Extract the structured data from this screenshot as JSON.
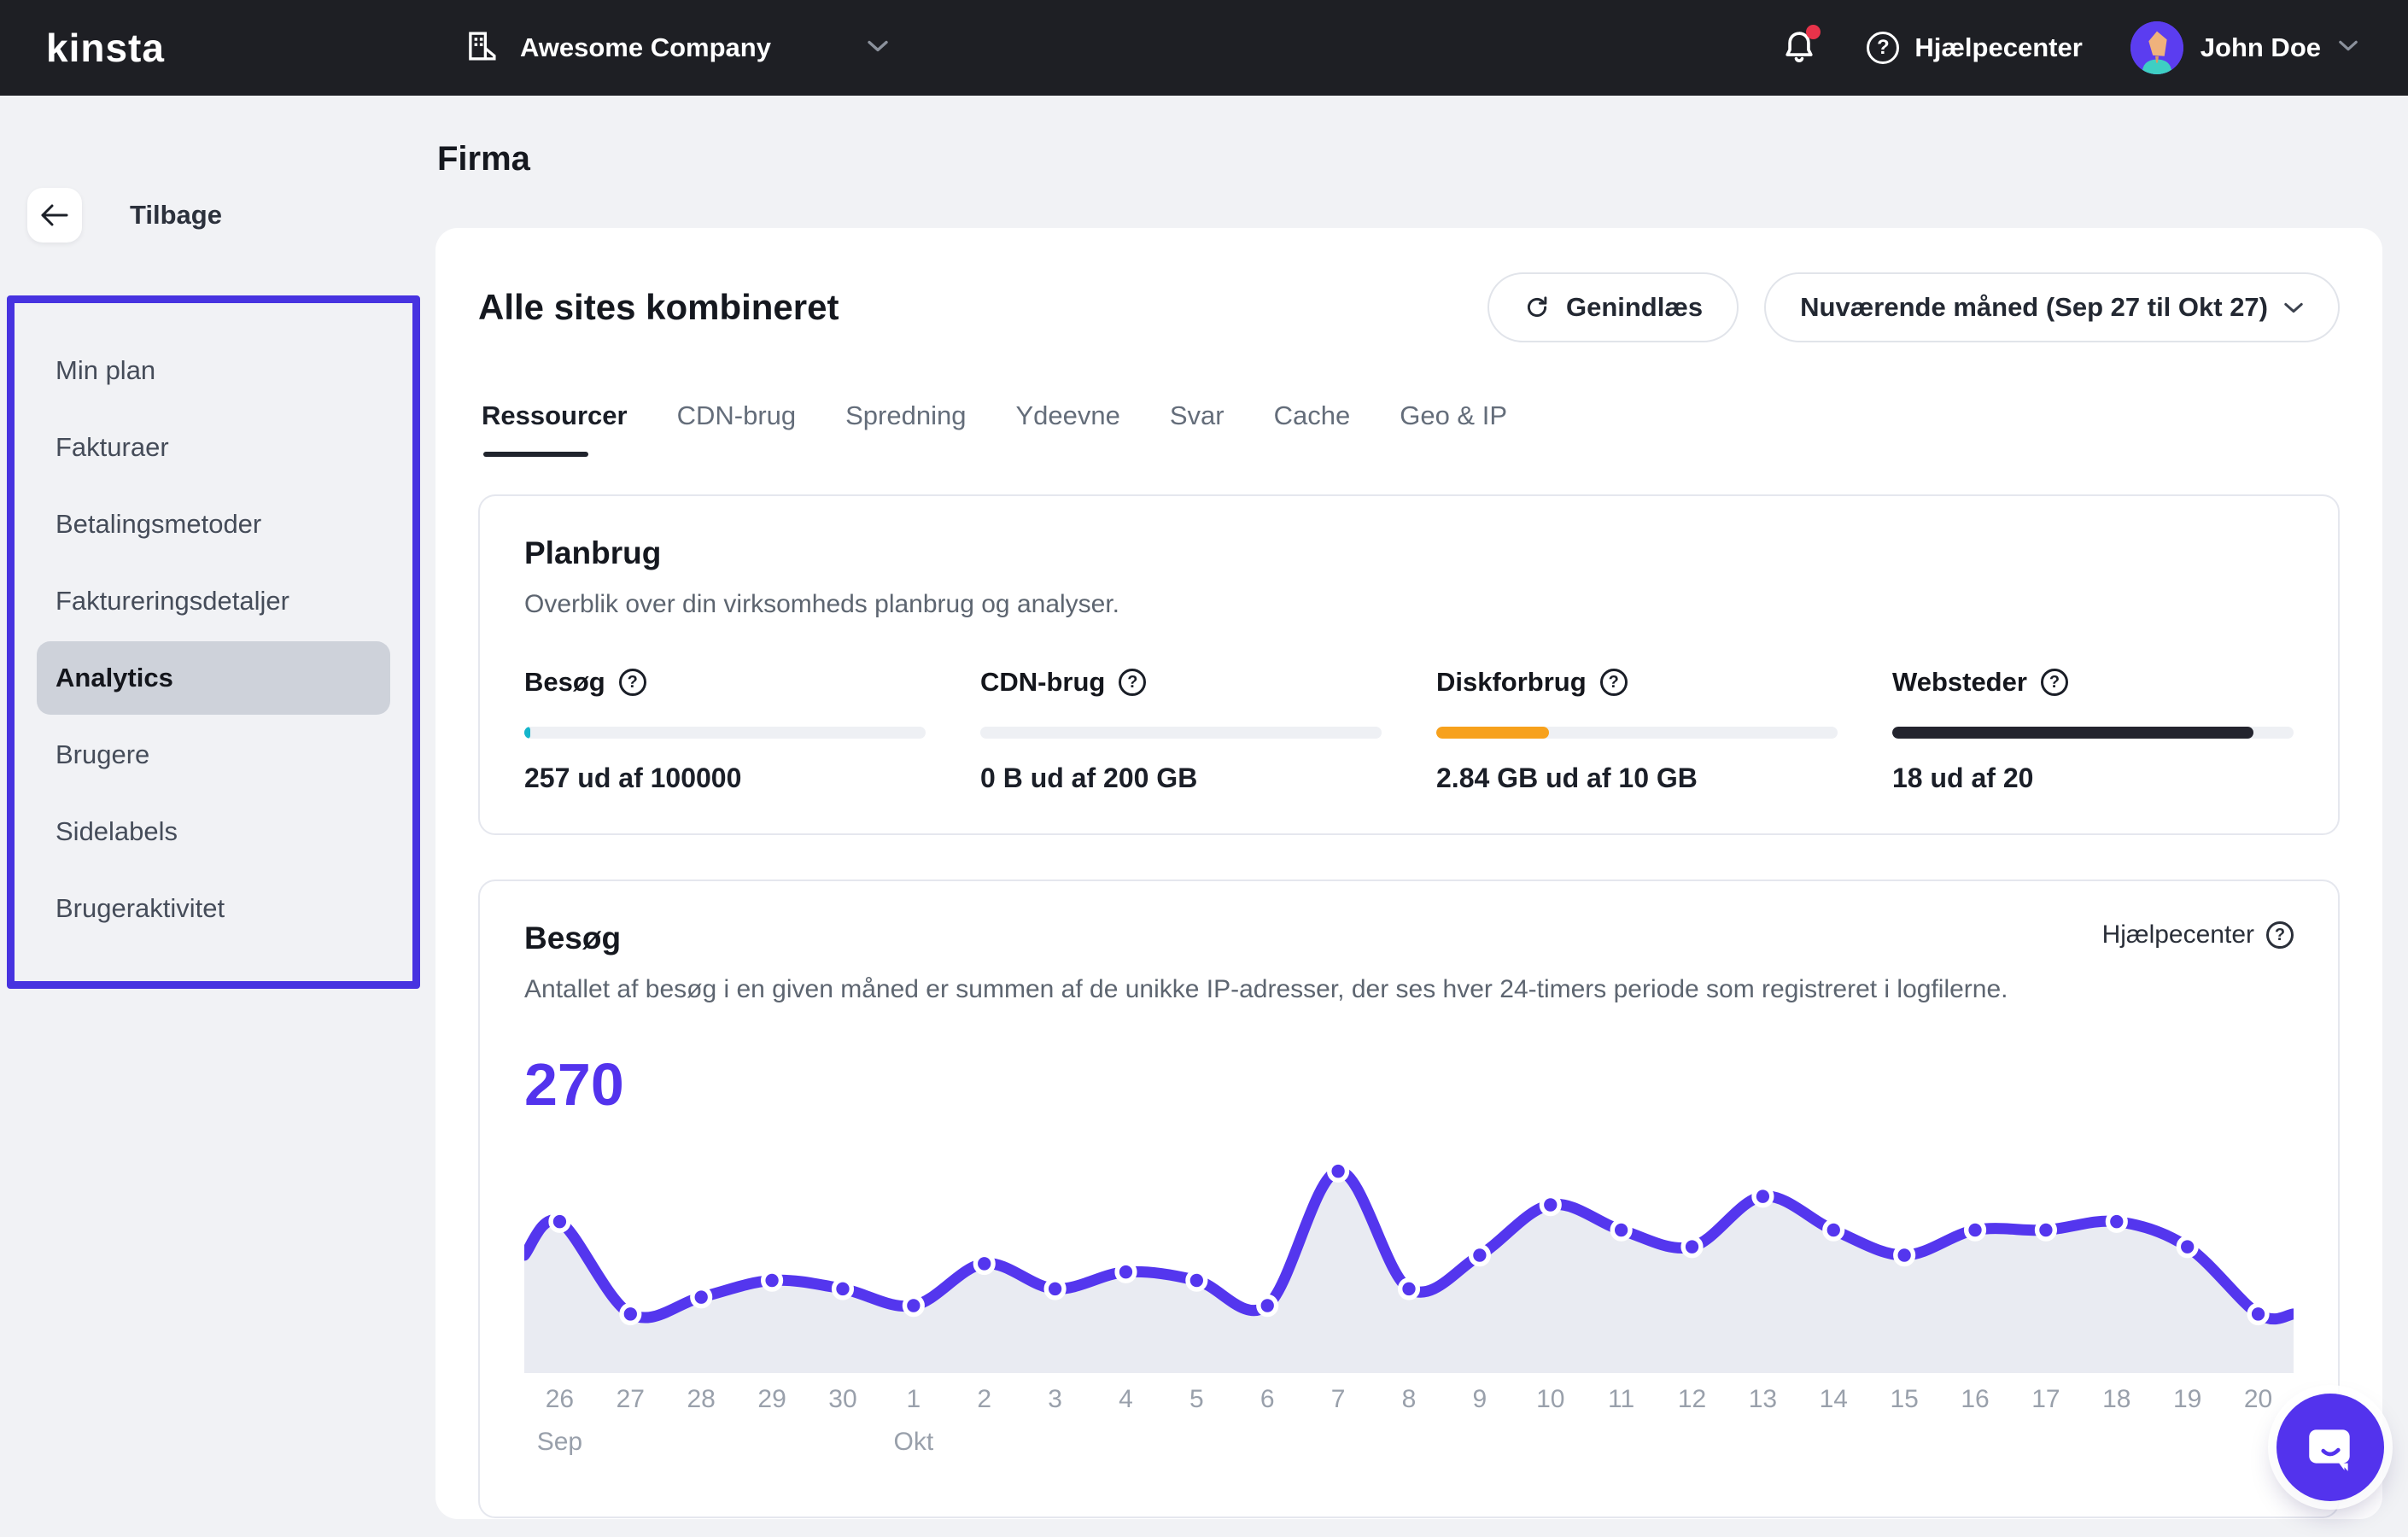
{
  "colors": {
    "accent_purple": "#5333ed",
    "nav_border_purple": "#4733e0",
    "topbar_bg": "#1e1f24",
    "notification_dot": "#e8334a",
    "progress_teal": "#14b5cb",
    "progress_orange": "#f7a11c",
    "progress_dark": "#23242e",
    "chart_line": "#5436ee",
    "chart_area": "#e9ebf2"
  },
  "topbar": {
    "brand": "Kinsta",
    "company": "Awesome Company",
    "help_label": "Hjælpecenter",
    "user_name": "John Doe"
  },
  "sidebar": {
    "back_label": "Tilbage",
    "items": [
      {
        "label": "Min plan",
        "active": false
      },
      {
        "label": "Fakturaer",
        "active": false
      },
      {
        "label": "Betalingsmetoder",
        "active": false
      },
      {
        "label": "Faktureringsdetaljer",
        "active": false
      },
      {
        "label": "Analytics",
        "active": true
      },
      {
        "label": "Brugere",
        "active": false
      },
      {
        "label": "Sidelabels",
        "active": false
      },
      {
        "label": "Brugeraktivitet",
        "active": false
      }
    ]
  },
  "page": {
    "title": "Firma"
  },
  "panel": {
    "title": "Alle sites kombineret",
    "reload_label": "Genindlæs",
    "period_label": "Nuværende måned (Sep 27 til Okt 27)"
  },
  "tabs": [
    {
      "label": "Ressourcer",
      "active": true
    },
    {
      "label": "CDN-brug",
      "active": false
    },
    {
      "label": "Spredning",
      "active": false
    },
    {
      "label": "Ydeevne",
      "active": false
    },
    {
      "label": "Svar",
      "active": false
    },
    {
      "label": "Cache",
      "active": false
    },
    {
      "label": "Geo & IP",
      "active": false
    }
  ],
  "plan_usage": {
    "title": "Planbrug",
    "subtitle": "Overblik over din virksomheds planbrug og analyser.",
    "metrics": [
      {
        "label": "Besøg",
        "value": "257 ud af 100000",
        "percent": 0.3,
        "color": "#14b5cb"
      },
      {
        "label": "CDN-brug",
        "value": "0 B ud af 200 GB",
        "percent": 0,
        "color": "#14b5cb"
      },
      {
        "label": "Diskforbrug",
        "value": "2.84 GB ud af 10 GB",
        "percent": 28,
        "color": "#f7a11c"
      },
      {
        "label": "Websteder",
        "value": "18 ud af 20",
        "percent": 90,
        "color": "#23242e"
      }
    ]
  },
  "visits": {
    "title": "Besøg",
    "help_label": "Hjælpecenter",
    "subtitle": "Antallet af besøg i en given måned er summen af de unikke IP-adresser, der ses hver 24-timers periode som registreret i logfilerne.",
    "total": "270"
  },
  "chart_data": {
    "type": "line",
    "title": "Besøg",
    "x": [
      "26",
      "27",
      "28",
      "29",
      "30",
      "1",
      "2",
      "3",
      "4",
      "5",
      "6",
      "7",
      "8",
      "9",
      "10",
      "11",
      "12",
      "13",
      "14",
      "15",
      "16",
      "17",
      "18",
      "19",
      "20"
    ],
    "month_markers": [
      {
        "index": 0,
        "label": "Sep"
      },
      {
        "index": 5,
        "label": "Okt"
      }
    ],
    "series": [
      {
        "name": "Besøg",
        "values": [
          16,
          5,
          7,
          9,
          8,
          6,
          11,
          8,
          10,
          9,
          6,
          22,
          8,
          12,
          18,
          15,
          13,
          19,
          15,
          12,
          15,
          15,
          16,
          13,
          5
        ]
      }
    ],
    "edge_line": [
      12,
      5
    ],
    "ylim": [
      0,
      24
    ],
    "grid": false,
    "legend": false,
    "line_color": "#5436ee",
    "area_color": "#e9ebf2"
  }
}
